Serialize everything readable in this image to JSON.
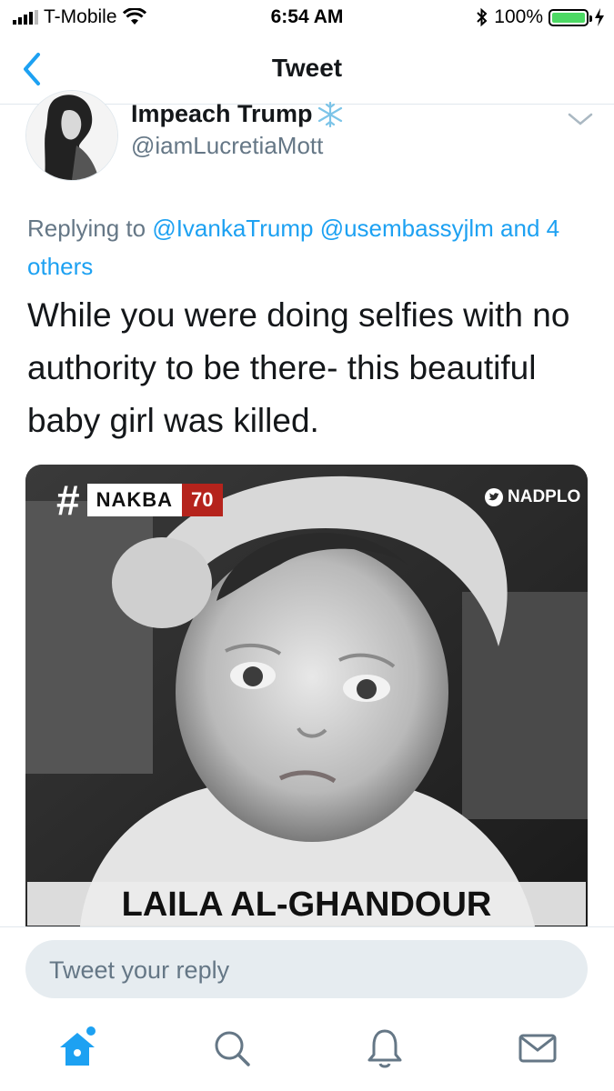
{
  "status_bar": {
    "carrier": "T-Mobile",
    "time": "6:54 AM",
    "battery": "100%",
    "battery_level": 1.0
  },
  "nav": {
    "title": "Tweet"
  },
  "tweet": {
    "display_name": "Impeach Trump",
    "handle": "@iamLucretiaMott",
    "replying_prefix": "Replying to",
    "replying_to": [
      "@IvankaTrump",
      "@usembassyjlm"
    ],
    "replying_others": "and 4 others",
    "text": "While you were doing selfies with no authority to be there- this beautiful baby girl was killed.",
    "media": {
      "hash": "#",
      "tag_word": "NAKBA",
      "tag_number": "70",
      "source": "NADPLO",
      "caption": "LAILA AL-GHANDOUR"
    }
  },
  "reply": {
    "placeholder": "Tweet your reply"
  },
  "colors": {
    "accent": "#1da1f2",
    "secondary_text": "#657786",
    "tag_red": "#b5231c"
  },
  "tabbar": {
    "items": [
      "home-icon",
      "search-icon",
      "notifications-bell-icon",
      "messages-envelope-icon"
    ]
  }
}
